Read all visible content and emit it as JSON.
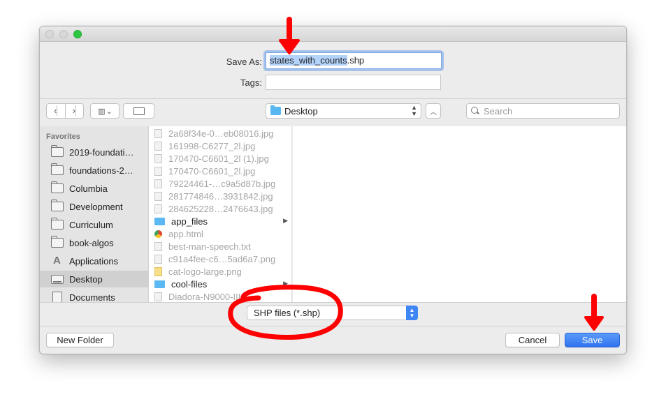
{
  "dialog": {
    "save_as_label": "Save As:",
    "filename_selected": "states_with_counts",
    "filename_ext": ".shp",
    "tags_label": "Tags:"
  },
  "toolbar": {
    "back_icon": "chevron-left-icon",
    "forward_icon": "chevron-right-icon",
    "view_icon": "column-view-icon",
    "new_folder_icon": "new-folder-icon",
    "location": "Desktop",
    "search_placeholder": "Search"
  },
  "sidebar": {
    "header": "Favorites",
    "items": [
      {
        "label": "2019-foundati…",
        "icon": "folder-icon"
      },
      {
        "label": "foundations-2…",
        "icon": "folder-icon"
      },
      {
        "label": "Columbia",
        "icon": "folder-icon"
      },
      {
        "label": "Development",
        "icon": "folder-icon"
      },
      {
        "label": "Curriculum",
        "icon": "folder-icon"
      },
      {
        "label": "book-algos",
        "icon": "folder-icon"
      },
      {
        "label": "Applications",
        "icon": "applications-icon"
      },
      {
        "label": "Desktop",
        "icon": "desktop-icon",
        "active": true
      },
      {
        "label": "Documents",
        "icon": "document-icon"
      }
    ]
  },
  "files": [
    {
      "name": "2a68f34e-0…eb08016.jpg",
      "type": "image",
      "enabled": false
    },
    {
      "name": "161998-C6277_2l.jpg",
      "type": "image",
      "enabled": false
    },
    {
      "name": "170470-C6601_2l (1).jpg",
      "type": "image",
      "enabled": false
    },
    {
      "name": "170470-C6601_2l.jpg",
      "type": "image",
      "enabled": false
    },
    {
      "name": "79224461-…c9a5d87b.jpg",
      "type": "image",
      "enabled": false
    },
    {
      "name": "281774846…3931842.jpg",
      "type": "image",
      "enabled": false
    },
    {
      "name": "284625228…2476643.jpg",
      "type": "image",
      "enabled": false
    },
    {
      "name": "app_files",
      "type": "folder",
      "enabled": true
    },
    {
      "name": "app.html",
      "type": "html",
      "enabled": false
    },
    {
      "name": "best-man-speech.txt",
      "type": "text",
      "enabled": false
    },
    {
      "name": "c91a4fee-c6…5ad6a7.png",
      "type": "image",
      "enabled": false
    },
    {
      "name": "cat-logo-large.png",
      "type": "image",
      "enabled": false
    },
    {
      "name": "cool-files",
      "type": "folder",
      "enabled": true
    },
    {
      "name": "Diadora-N9000-III…",
      "type": "image",
      "enabled": false
    }
  ],
  "footer": {
    "format": "SHP files (*.shp)",
    "new_folder": "New Folder",
    "cancel": "Cancel",
    "save": "Save"
  },
  "annotation_color": "#ff0000"
}
